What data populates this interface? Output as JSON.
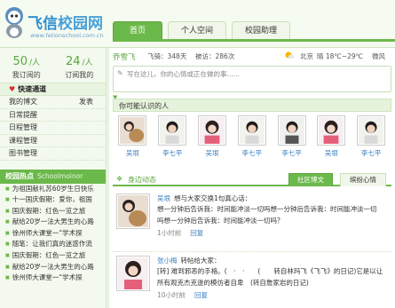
{
  "brand": {
    "logo_cn": "飞信",
    "logo_cn2": "校园网",
    "url": "www.fetionschool.com.cn"
  },
  "nav": {
    "tabs": [
      "首页",
      "个人空间",
      "校园助理"
    ],
    "active_index": 0
  },
  "sidebar": {
    "stats": [
      {
        "value": "50",
        "unit": "人",
        "label": "我订阅的"
      },
      {
        "value": "24",
        "unit": "人",
        "label": "订阅我的"
      }
    ],
    "quick_title": "快速通道",
    "menu": [
      {
        "label": "我的博文",
        "right": "发表"
      },
      {
        "label": "日常提醒"
      },
      {
        "label": "日程管理"
      },
      {
        "label": "课程管理"
      },
      {
        "label": "图书管理"
      }
    ],
    "hot_title": "校园热点",
    "hot_title_en": "Schoolmoinor",
    "hot_items": [
      "为祖国献礼苏60岁生日快乐",
      "十一国庆假期：爱你，祖国",
      "国庆假期：红色一览之旅",
      "献给20岁一法大男生的心路",
      "徐州师大课堂一“学术探",
      "随笔：让我们真的迷惑作流",
      "国庆假期：红色一览之旅",
      "献给20岁一法大男生的心路",
      "徐州师大课堂一“学术探"
    ]
  },
  "user_bar": {
    "name": "乔雪飞",
    "role_label": "飞骑：348天",
    "points": "被访：286次",
    "city": "北京",
    "temp": "晴 18℃~29℃",
    "wind": "微风"
  },
  "status_input": {
    "placeholder": "写在这儿，你的心情或正在做的事......"
  },
  "friends": {
    "title": "你可能认识的人",
    "list": [
      {
        "name": "吴垠"
      },
      {
        "name": "李七平"
      },
      {
        "name": "吴垠"
      },
      {
        "name": "李七平"
      },
      {
        "name": "李七平"
      },
      {
        "name": "吴垠"
      },
      {
        "name": "李七平"
      }
    ]
  },
  "dynamics": {
    "title": "身边动态",
    "tabs": [
      "社区博文",
      "缤纷心情"
    ],
    "active_index": 0
  },
  "posts": [
    {
      "author": "吴垠",
      "lines": [
        "想与大家交换1句真心话：",
        "想一分钟后告诉我：时间能冲淡一切吗想一分钟后告诉我：时间能冲淡一切",
        "吗想一分钟后告诉我：时间能冲淡一切吗？"
      ],
      "time": "1小时前",
      "reply": "回复"
    },
    {
      "author": "张小梅",
      "lines": [
        "转帖给大家：",
        "[转] 难到邪恶的手格。(　·　·　　(　　转自林玛飞《飞飞》的日记)它是以让",
        "所有观克杰克逊的模仿者自卑　(转自詹家岩的日记)"
      ],
      "time": "10小时前",
      "reply": "回复"
    }
  ]
}
